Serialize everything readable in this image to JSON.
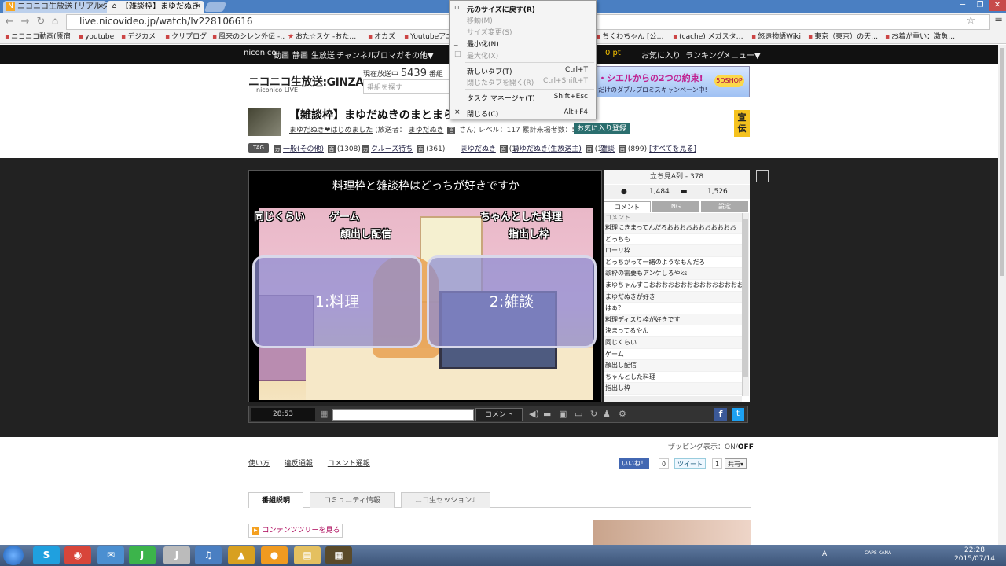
{
  "browser": {
    "tabs": [
      {
        "label": "ニコニコ生放送 [リアルタ",
        "close": "×"
      },
      {
        "label": "【雑談枠】まゆだぬき",
        "close": "×"
      }
    ],
    "url": "live.nicovideo.jp/watch/lv228106616",
    "bookmarks": [
      "ニコニコ動画(原宿)",
      "youtube",
      "デジカメ",
      "クリプログ",
      "風来のシレン外伝 -…",
      "おた☆スケ -おた…",
      "オカズ",
      "Youtubeアニ…",
      "ちくわちゃん [公…",
      "(cache) メガスタ…",
      "悠遠物語Wiki",
      "東京（東京）の天…",
      "お着が重い：激魚…"
    ]
  },
  "context_menu": {
    "items": [
      {
        "label": "元のサイズに戻す(R)",
        "shortcut": "",
        "disabled": false,
        "icon": "restore-icon",
        "bold": true
      },
      {
        "label": "移動(M)",
        "shortcut": "",
        "disabled": true
      },
      {
        "label": "サイズ変更(S)",
        "shortcut": "",
        "disabled": true
      },
      {
        "label": "最小化(N)",
        "shortcut": "",
        "disabled": false,
        "icon": "minimize-icon"
      },
      {
        "label": "最大化(X)",
        "shortcut": "",
        "disabled": true,
        "icon": "maximize-icon"
      },
      {
        "label": "新しいタブ(T)",
        "shortcut": "Ctrl+T",
        "disabled": false
      },
      {
        "label": "閉じたタブを開く(R)",
        "shortcut": "Ctrl+Shift+T",
        "disabled": true
      },
      {
        "label": "タスク マネージャ(T)",
        "shortcut": "Shift+Esc",
        "disabled": false
      },
      {
        "label": "閉じる(C)",
        "shortcut": "Alt+F4",
        "disabled": false,
        "icon": "close-icon"
      }
    ]
  },
  "site_nav": {
    "left": [
      "niconico",
      "動画",
      "静画",
      "生放送",
      "チャンネル",
      "ブロマガ",
      "その他▼"
    ],
    "points": "0 pt",
    "right": [
      "お気に入り",
      "ランキング",
      "メニュー▼"
    ]
  },
  "header": {
    "logo": "ニコニコ生放送:GINZA",
    "logo_sub": "niconico LIVE",
    "onair_label": "現在放送中",
    "onair_count": "5439",
    "onair_unit": "番組",
    "search_placeholder": "番組を探す",
    "banner_text": "・シエルからの2つの約束!",
    "banner_sub": "だけのダブルプロミスキャンペーン中!",
    "banner_badge": "5DSHOP"
  },
  "program": {
    "title": "【雑談枠】まゆだぬきのまとまらな",
    "community": "まゆだぬき❤はじめました",
    "caster_label": "(放送者：",
    "caster": "まゆだぬき",
    "level": "さん) レベル：117 累計来場者数：5,779,726",
    "fav_button": "お気に入り登録",
    "senden": "宣伝",
    "tags": [
      {
        "label": "一般(その他)",
        "count": "(1308)"
      },
      {
        "label": "クルーズ待ち",
        "count": "(361)"
      },
      {
        "label": "まゆだぬき",
        "count": "(1)"
      },
      {
        "label": "まゆだぬき(生放送主)",
        "count": "(1)"
      },
      {
        "label": "雑談",
        "count": "(899)"
      }
    ],
    "tags_all": "[すべてを見る]",
    "tag_badge": "TAG"
  },
  "video": {
    "telop": "料理枠と雑談枠はどっちが好きですか",
    "overlays": [
      "同じくらい",
      "ゲーム",
      "顔出し配信",
      "ちゃんとした料理",
      "指出し枠"
    ],
    "choice1": "1:料理",
    "choice2": "2:雑談"
  },
  "side": {
    "header": "立ち見A列 - 378",
    "viewers": "1,484",
    "comments": "1,526",
    "tabs": [
      "コメント",
      "NG",
      "設定"
    ],
    "list_header": "コメント",
    "comments_list": [
      "料理にきまってんだろおおおおおおおおおおお",
      "どっちも",
      "ローリ枠",
      "どっちがって一緒のようなもんだろ",
      "歌枠の需要もアンケしろやks",
      "まゆちゃんすこおおおおおおおおおおおおおおおお",
      "まゆだぬきが好き",
      "はぁ？",
      "料理ディスり枠が好きです",
      "決まってるやん",
      "同じくらい",
      "ゲーム",
      "顔出し配信",
      "ちゃんとした料理",
      "指出し枠"
    ]
  },
  "player_bar": {
    "time": "28:53",
    "comment_button": "コメント"
  },
  "zapping": {
    "label": "ザッピング表示：",
    "on": "ON",
    "sep": "/",
    "off": "OFF"
  },
  "footer_links": [
    "使い方",
    "違反通報",
    "コメント通報"
  ],
  "share": {
    "like": "いいね！",
    "like_count": "0",
    "tweet": "ツイート",
    "tweet_count": "1",
    "share": "共有▾"
  },
  "program_tabs": [
    "番組説明",
    "コミュニティ情報",
    "ニコ生セッション♪"
  ],
  "tree_button": "コンテンツツリーを見る",
  "taskbar": {
    "apps": [
      "S",
      "◉",
      "✉",
      "J",
      "J",
      "♫",
      "▲",
      "●",
      "▤",
      "▦"
    ],
    "tray": [
      "A",
      "CAPS KANA"
    ],
    "time": "22:28",
    "date": "2015/07/14"
  },
  "colors": {
    "accent": "#2a6e6e",
    "nav_bg": "#111111",
    "player_bg": "#222222"
  }
}
